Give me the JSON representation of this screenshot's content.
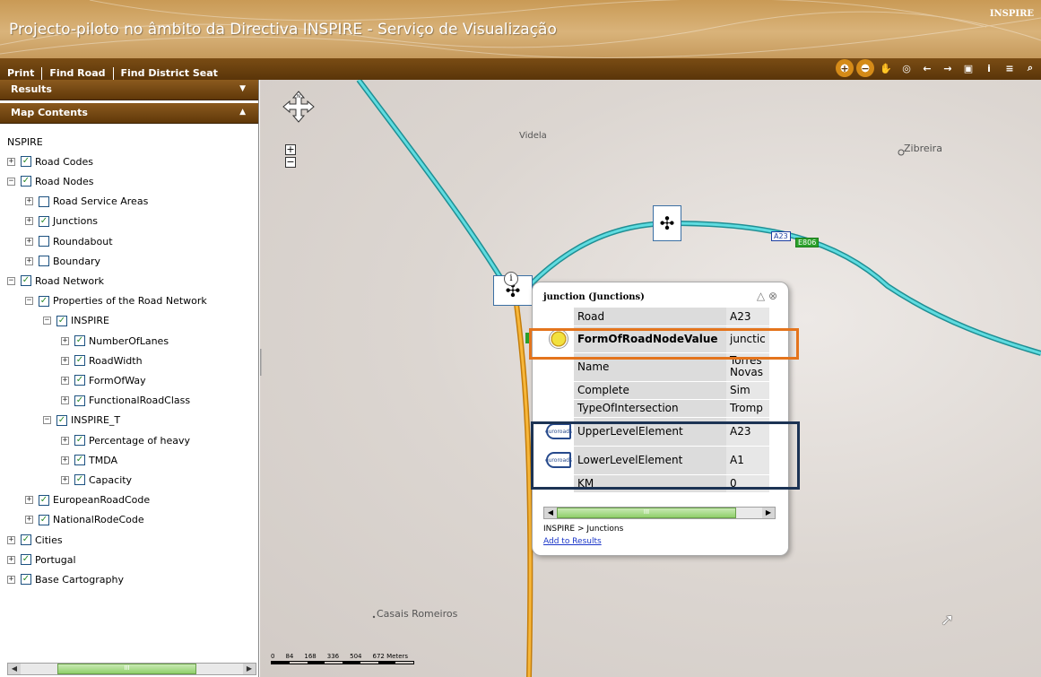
{
  "header": {
    "title": "Projecto-piloto no âmbito da Directiva INSPIRE - Serviço de Visualização",
    "brand": "INSPIRE"
  },
  "menu": {
    "items": [
      "Print",
      "Find Road",
      "Find District Seat"
    ]
  },
  "tools": [
    {
      "name": "zoom-in-icon",
      "glyph": "+"
    },
    {
      "name": "zoom-out-icon",
      "glyph": "−"
    },
    {
      "name": "pan-hand-icon",
      "glyph": "✋"
    },
    {
      "name": "full-extent-icon",
      "glyph": "◎"
    },
    {
      "name": "previous-extent-icon",
      "glyph": "←"
    },
    {
      "name": "next-extent-icon",
      "glyph": "→"
    },
    {
      "name": "select-icon",
      "glyph": "▣"
    },
    {
      "name": "identify-icon",
      "glyph": "i"
    },
    {
      "name": "measure-icon",
      "glyph": "≡"
    },
    {
      "name": "search-icon",
      "glyph": "⌕"
    }
  ],
  "sidebar": {
    "results_label": "Results",
    "contents_label": "Map Contents",
    "tree": [
      {
        "label": "NSPIRE",
        "level": 0,
        "exp": "",
        "chk": null
      },
      {
        "label": "Road Codes",
        "level": 0,
        "exp": "+",
        "chk": true
      },
      {
        "label": "Road Nodes",
        "level": 0,
        "exp": "−",
        "chk": true
      },
      {
        "label": "Road Service Areas",
        "level": 1,
        "exp": "+",
        "chk": false
      },
      {
        "label": "Junctions",
        "level": 1,
        "exp": "+",
        "chk": true
      },
      {
        "label": "Roundabout",
        "level": 1,
        "exp": "+",
        "chk": false
      },
      {
        "label": "Boundary",
        "level": 1,
        "exp": "+",
        "chk": false
      },
      {
        "label": "Road Network",
        "level": 0,
        "exp": "−",
        "chk": true
      },
      {
        "label": "Properties of the Road Network",
        "level": 1,
        "exp": "−",
        "chk": true
      },
      {
        "label": "INSPIRE",
        "level": 2,
        "exp": "−",
        "chk": true
      },
      {
        "label": "NumberOfLanes",
        "level": 3,
        "exp": "+",
        "chk": true
      },
      {
        "label": "RoadWidth",
        "level": 3,
        "exp": "+",
        "chk": true
      },
      {
        "label": "FormOfWay",
        "level": 3,
        "exp": "+",
        "chk": true
      },
      {
        "label": "FunctionalRoadClass",
        "level": 3,
        "exp": "+",
        "chk": true
      },
      {
        "label": "INSPIRE_T",
        "level": 2,
        "exp": "−",
        "chk": true
      },
      {
        "label": "Percentage of heavy",
        "level": 3,
        "exp": "+",
        "chk": true
      },
      {
        "label": "TMDA",
        "level": 3,
        "exp": "+",
        "chk": true
      },
      {
        "label": "Capacity",
        "level": 3,
        "exp": "+",
        "chk": true
      },
      {
        "label": "EuropeanRoadCode",
        "level": 1,
        "exp": "+",
        "chk": true
      },
      {
        "label": "NationalRodeCode",
        "level": 1,
        "exp": "+",
        "chk": true
      },
      {
        "label": "Cities",
        "level": 0,
        "exp": "+",
        "chk": true
      },
      {
        "label": "Portugal",
        "level": 0,
        "exp": "+",
        "chk": true
      },
      {
        "label": "Base Cartography",
        "level": 0,
        "exp": "+",
        "chk": true
      }
    ],
    "scroll_grip": "III"
  },
  "map": {
    "places": {
      "videla": "Videla",
      "zibreira": "Zibreira",
      "casais": "Casais Romeiros"
    },
    "shields": {
      "a23": "A23",
      "e806": "E806"
    },
    "scale": {
      "ticks": [
        "0",
        "84",
        "168",
        "336",
        "504",
        "672 Meters"
      ]
    },
    "pan_label": "N"
  },
  "popup": {
    "title": "junction (Junctions)",
    "rows": [
      {
        "icon": "",
        "field": "Road",
        "value": "A23",
        "bold": false
      },
      {
        "icon": "disc",
        "field": "FormOfRoadNodeValue",
        "value": "junctic",
        "bold": true
      },
      {
        "icon": "",
        "field": "Name",
        "value": "Torres Novas",
        "bold": false
      },
      {
        "icon": "",
        "field": "Complete",
        "value": "Sim",
        "bold": false
      },
      {
        "icon": "",
        "field": "TypeOfIntersection",
        "value": "Tromp",
        "bold": false
      },
      {
        "icon": "euro",
        "field": "UpperLevelElement",
        "value": "A23",
        "bold": false
      },
      {
        "icon": "euro",
        "field": "LowerLevelElement",
        "value": "A1",
        "bold": false
      },
      {
        "icon": "",
        "field": "KM",
        "value": "0",
        "bold": false
      }
    ],
    "euro_icon_text": "euroroads",
    "scroll_grip": "III",
    "breadcrumb": "INSPIRE > Junctions",
    "add_link": "Add to Results"
  },
  "colors": {
    "accent": "#8b5a1e",
    "road_cyan": "#2bbfc4",
    "road_orange": "#f2a01c",
    "highlight_orange": "#e4741c",
    "highlight_blue": "#1c3354"
  }
}
